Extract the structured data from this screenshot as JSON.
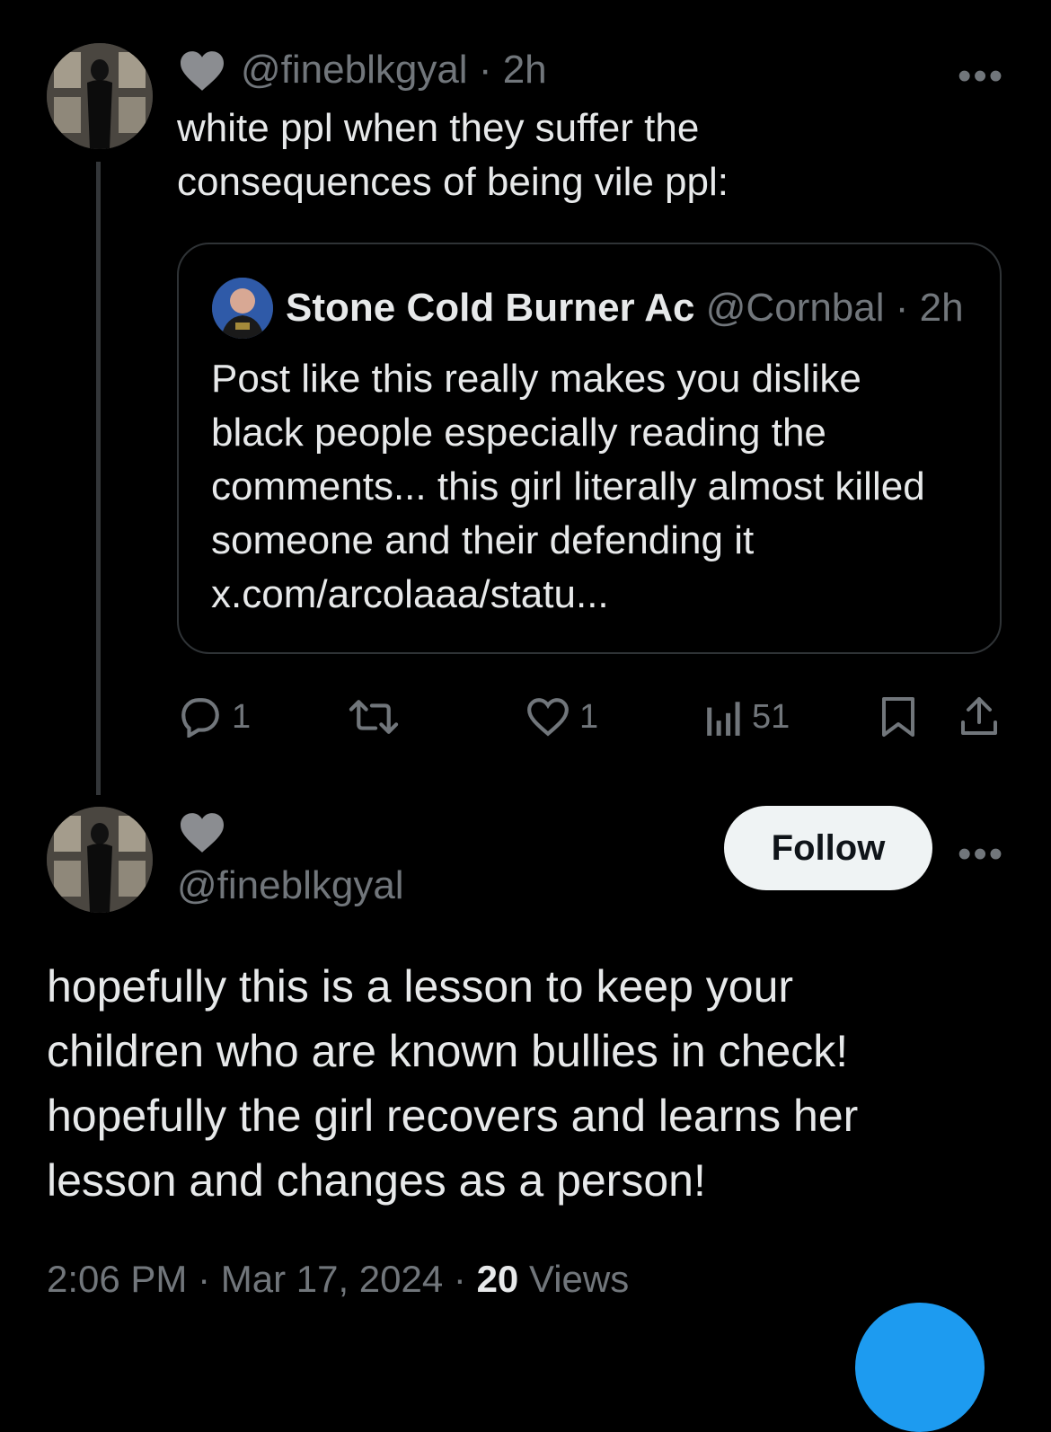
{
  "original_tweet": {
    "handle": "@fineblkgyal",
    "time": "· 2h",
    "text_line1": "white ppl when they suffer the",
    "text_line2": "consequences of being vile ppl:",
    "more_label": "•••"
  },
  "quoted_tweet": {
    "display_name": "Stone Cold Burner Ac",
    "handle": "@Cornbal",
    "time": "· 2h",
    "lines": [
      "Post like this really makes you dislike",
      "black people especially reading the",
      "comments... this girl literally almost killed",
      "someone and their defending it",
      "x.com/arcolaaa/statu..."
    ]
  },
  "actions": {
    "replies": "1",
    "likes": "1",
    "views": "51"
  },
  "reply_tweet": {
    "handle": "@fineblkgyal",
    "follow_label": "Follow",
    "more_label": "•••",
    "lines": [
      "hopefully this is a lesson to keep your",
      "children who are known bullies in check!",
      "hopefully the girl recovers and learns her",
      "lesson and changes as a person!"
    ],
    "timestamp": "2:06 PM · Mar 17, 2024 · ",
    "views_count": "20",
    "views_label": " Views"
  },
  "colors": {
    "background": "#000000",
    "text": "#e7e9ea",
    "muted": "#71767b",
    "border": "#2f3336",
    "accent": "#1d9bf0"
  }
}
